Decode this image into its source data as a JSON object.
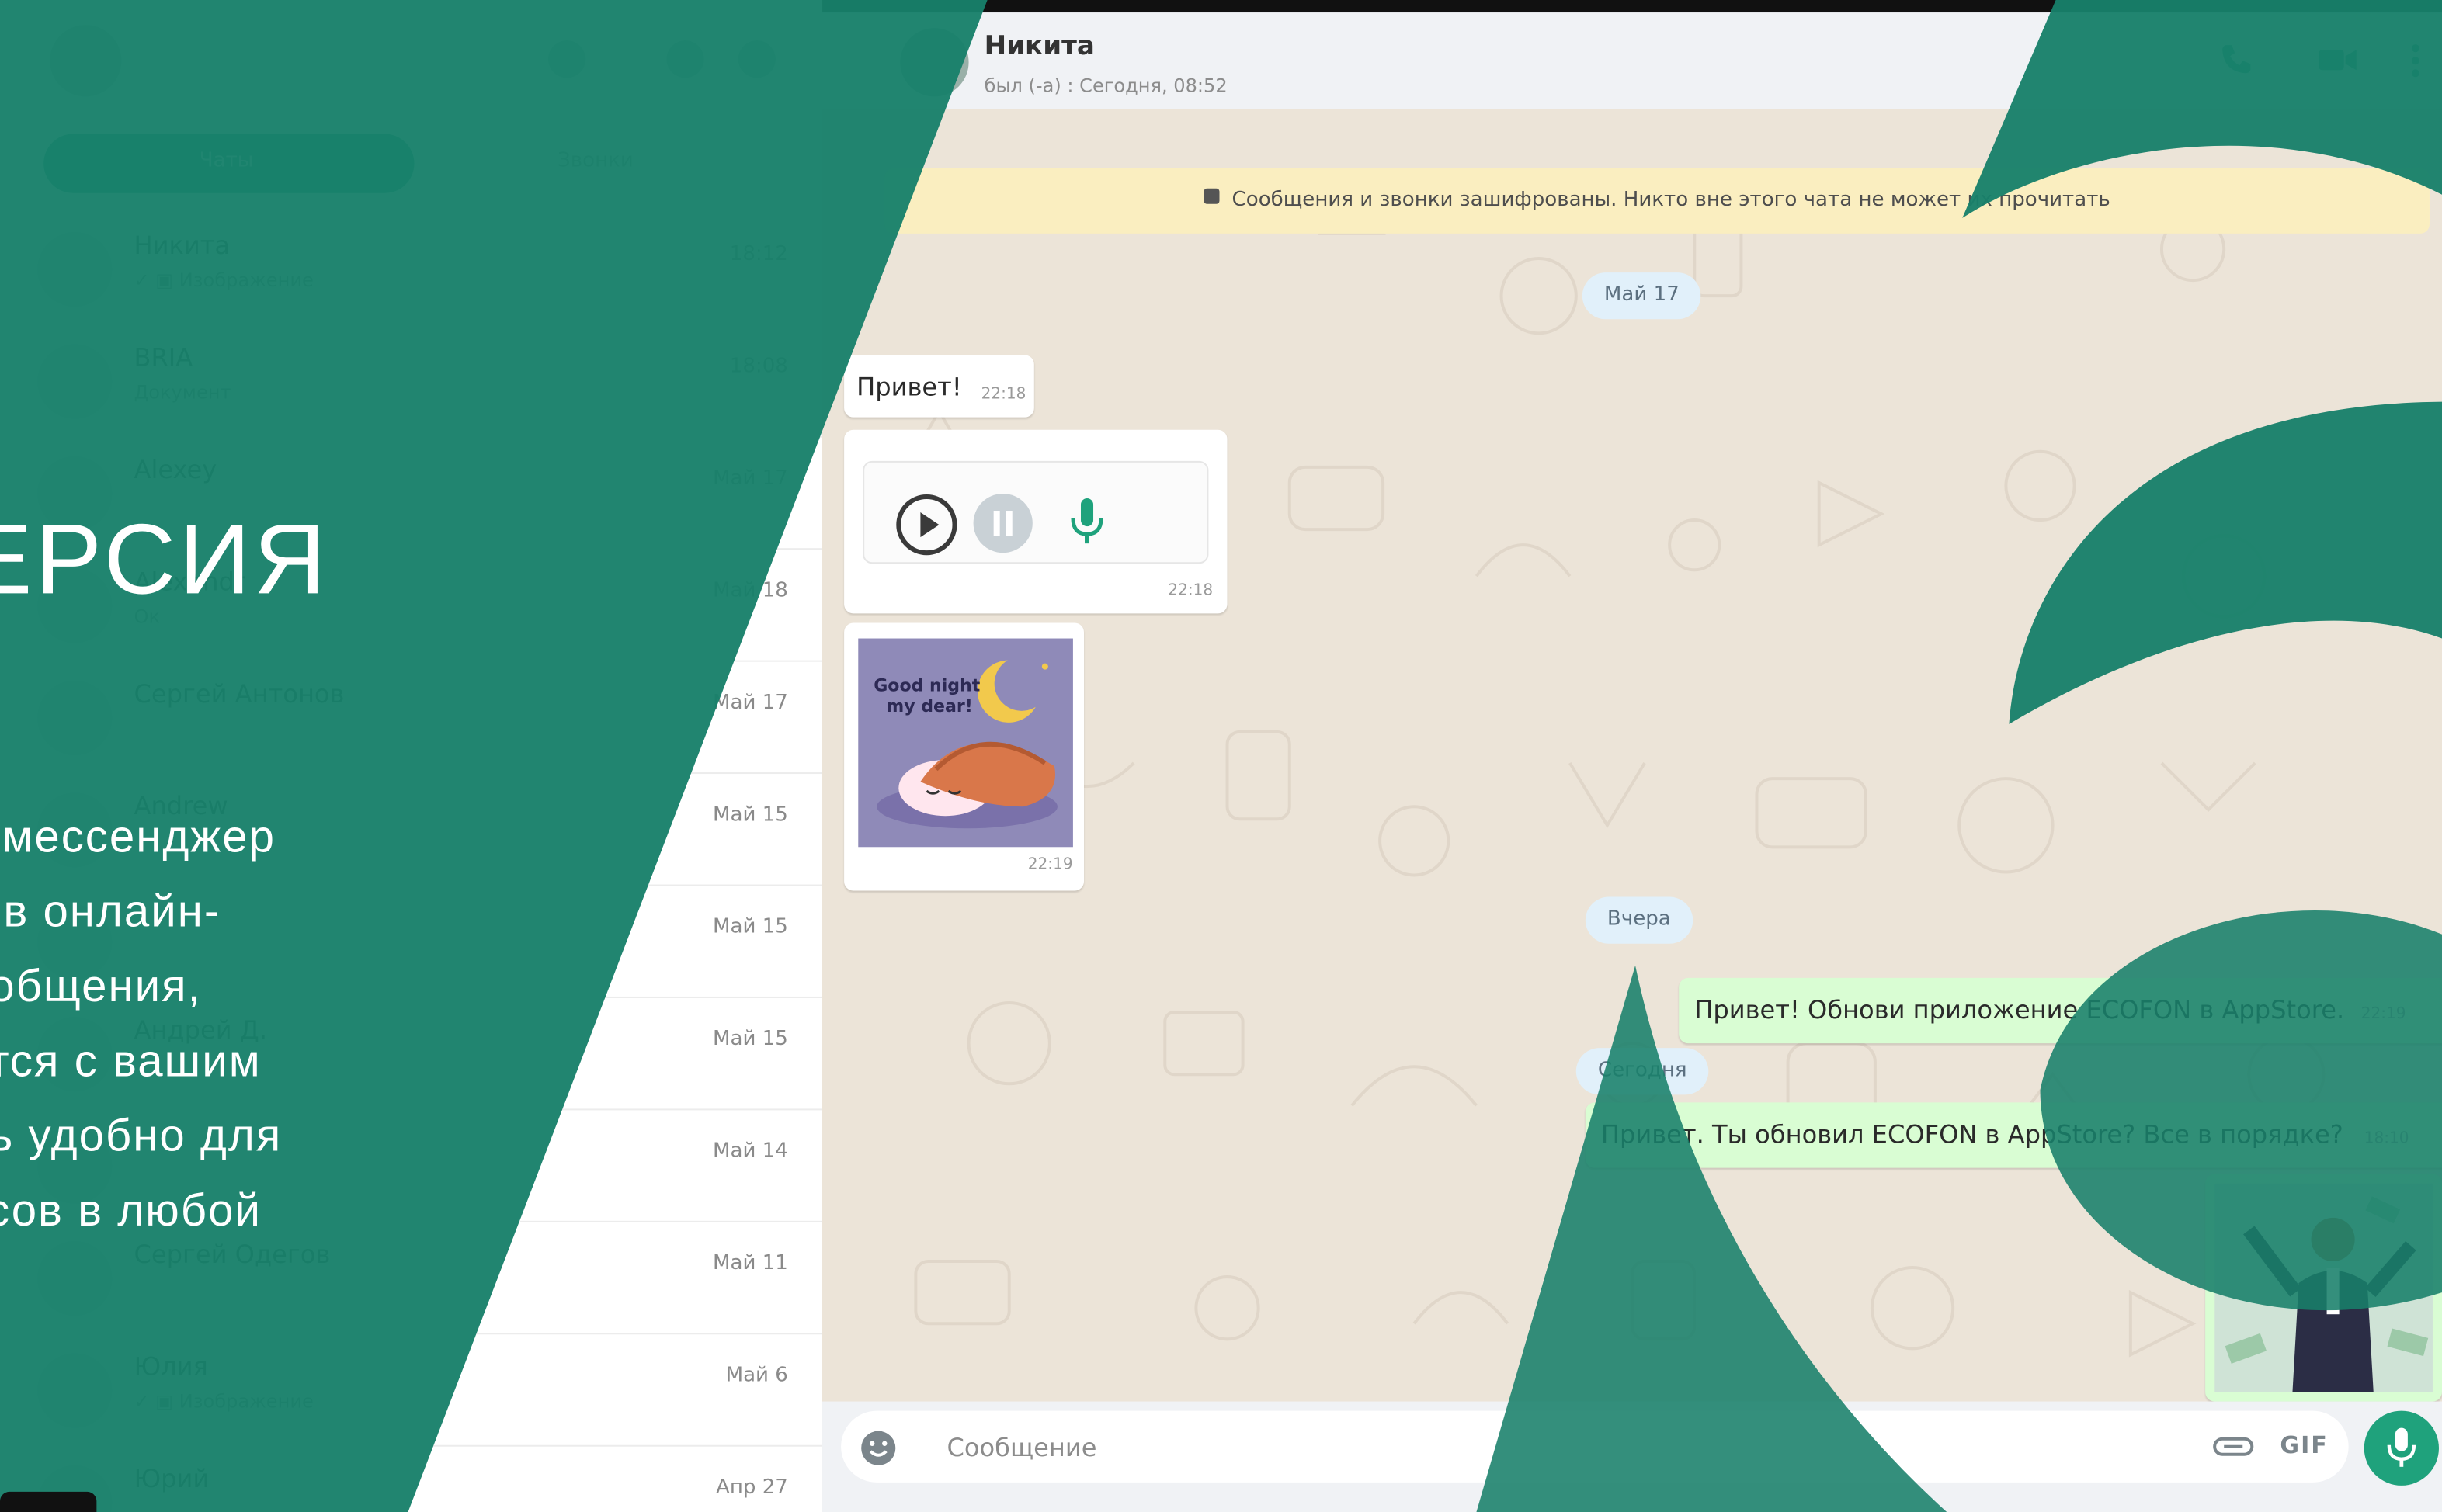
{
  "sidebar": {
    "tabs": {
      "chats": "Чаты",
      "calls": "Звонки"
    },
    "contacts": [
      {
        "name": "Никита",
        "preview": "✓ ▣ Изображение",
        "date": "18:12"
      },
      {
        "name": "BRIA",
        "preview": "Документ",
        "date": "18:08"
      },
      {
        "name": "Alexey",
        "preview": "",
        "date": "Май 17"
      },
      {
        "name": "Alexandr",
        "preview": "Ок",
        "date": "Май 18"
      },
      {
        "name": "Сергей Антонов",
        "preview": "",
        "date": "Май 17"
      },
      {
        "name": "Andrew",
        "preview": "",
        "date": "Май 15"
      },
      {
        "name": "",
        "preview": "",
        "date": "Май 15"
      },
      {
        "name": "Андрей Д.",
        "preview": "",
        "date": "Май 15"
      },
      {
        "name": "",
        "preview": "",
        "date": "Май 14"
      },
      {
        "name": "Сергей Одегов",
        "preview": "",
        "date": "Май 11"
      },
      {
        "name": "Юлия",
        "preview": "✓ ▣ Изображение",
        "date": "Май 6"
      },
      {
        "name": "Юрий",
        "preview": "",
        "date": "Апр 27"
      }
    ]
  },
  "chat": {
    "contact_name": "Никита",
    "status": "был (-а) : Сегодня, 08:52",
    "encryption_notice": "Сообщения и звонки зашифрованы. Никто вне этого чата не может их прочитать",
    "date_may17": "Май 17",
    "date_yesterday": "Вчера",
    "date_today": "Сегодня",
    "msg_hello": "Привет!",
    "msg_hello_time": "22:18",
    "voice_time": "22:18",
    "sticker_text_1": "Good night",
    "sticker_text_2": "my dear!",
    "sticker_time": "22:19",
    "msg_out_1": "Привет! Обнови приложение ECOFON в AppStore.",
    "msg_out_1_time": "22:19",
    "msg_out_2": "Привет. Ты обновил ECOFON в AppStore? Все в порядке?",
    "msg_out_2_time": "18:10",
    "composer_placeholder": "Сообщение",
    "gif_label": "GIF"
  },
  "promo": {
    "title": "ЕРСИЯ",
    "lines": [
      "ь мессенджер",
      "е в онлайн-",
      "ообщения,",
      "отся с вашим",
      "нь удобно для",
      "ссов в любой"
    ]
  },
  "colors": {
    "brand_green": "#18806a",
    "accent_green": "#1fa27c",
    "outgoing_bubble": "#d9fdd3",
    "banner_yellow": "#faeec0"
  }
}
